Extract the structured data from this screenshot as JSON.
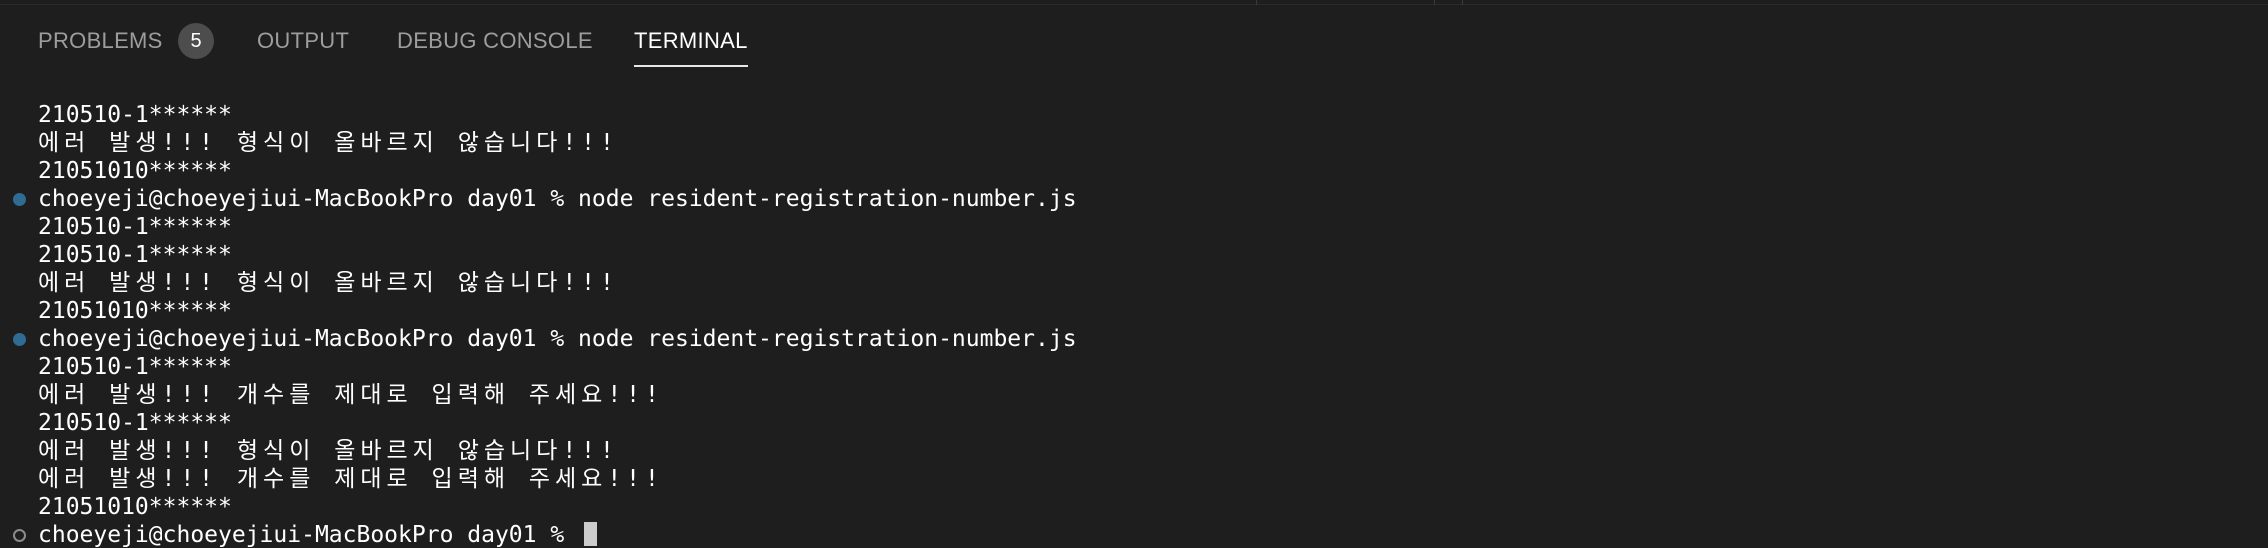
{
  "panel": {
    "tabs": [
      {
        "label": "PROBLEMS",
        "active": false
      },
      {
        "label": "OUTPUT",
        "active": false
      },
      {
        "label": "DEBUG CONSOLE",
        "active": false
      },
      {
        "label": "TERMINAL",
        "active": true
      }
    ],
    "problems_count": "5"
  },
  "terminal": {
    "lines": [
      {
        "text": "210510-1******",
        "marker": "none"
      },
      {
        "text": "에러 발생!!! 형식이 올바르지 않습니다!!!",
        "marker": "none"
      },
      {
        "text": "21051010******",
        "marker": "none"
      },
      {
        "text": "choeyeji@choeyejiui-MacBookPro day01 % node resident-registration-number.js",
        "marker": "success"
      },
      {
        "text": "210510-1******",
        "marker": "none"
      },
      {
        "text": "210510-1******",
        "marker": "none"
      },
      {
        "text": "에러 발생!!! 형식이 올바르지 않습니다!!!",
        "marker": "none"
      },
      {
        "text": "21051010******",
        "marker": "none"
      },
      {
        "text": "choeyeji@choeyejiui-MacBookPro day01 % node resident-registration-number.js",
        "marker": "success"
      },
      {
        "text": "210510-1******",
        "marker": "none"
      },
      {
        "text": "에러 발생!!! 개수를 제대로 입력해 주세요!!!",
        "marker": "none"
      },
      {
        "text": "210510-1******",
        "marker": "none"
      },
      {
        "text": "에러 발생!!! 형식이 올바르지 않습니다!!!",
        "marker": "none"
      },
      {
        "text": "에러 발생!!! 개수를 제대로 입력해 주세요!!!",
        "marker": "none"
      },
      {
        "text": "21051010******",
        "marker": "none"
      },
      {
        "text": "choeyeji@choeyejiui-MacBookPro day01 % ",
        "marker": "pending"
      }
    ]
  },
  "colors": {
    "background": "#1e1e1e",
    "text": "#ffffff",
    "inactive_tab": "#9d9d9d",
    "success_marker": "#2f6b92",
    "pending_marker": "#8d8d8d"
  },
  "icons": {
    "success_marker": "filled-circle-icon",
    "pending_marker": "hollow-circle-icon",
    "cursor": "block-cursor"
  }
}
